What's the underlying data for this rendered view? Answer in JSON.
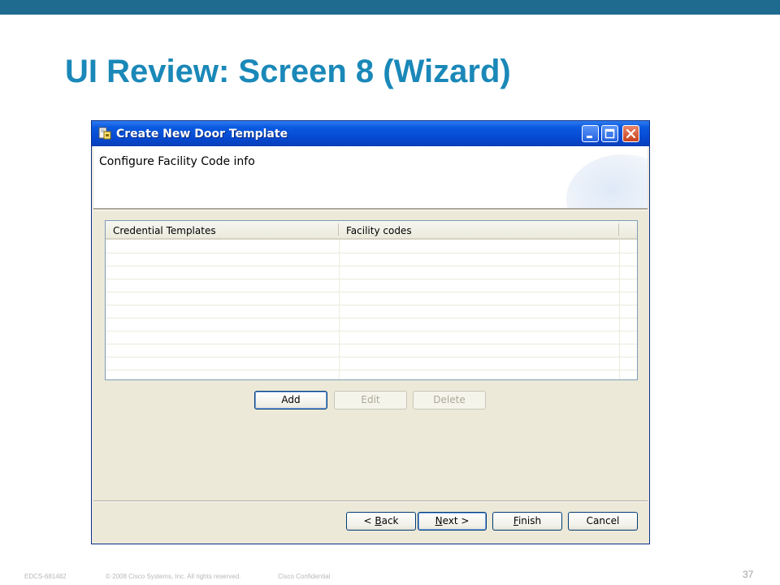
{
  "slide": {
    "title": "UI Review: Screen 8 (Wizard)",
    "footer_id": "EDCS-681482",
    "footer_copyright": "© 2008 Cisco Systems, Inc. All rights reserved.",
    "footer_confidential": "Cisco Confidential",
    "page_number": "37",
    "accent_color": "#1f6b8f"
  },
  "window": {
    "title": "Create New Door Template",
    "icon": "door-template-icon",
    "controls": [
      "minimize-icon",
      "maximize-icon",
      "close-icon"
    ]
  },
  "wizard": {
    "step_heading": "Configure Facility Code info",
    "table": {
      "columns": [
        "Credential Templates",
        "Facility codes"
      ],
      "rows": []
    },
    "actions": {
      "add": "Add",
      "edit": "Edit",
      "delete": "Delete"
    },
    "nav": {
      "back_prefix": "< ",
      "back_mnemonic": "B",
      "back_rest": "ack",
      "next_mnemonic": "N",
      "next_rest": "ext >",
      "finish_mnemonic": "F",
      "finish_rest": "inish",
      "cancel": "Cancel"
    }
  }
}
